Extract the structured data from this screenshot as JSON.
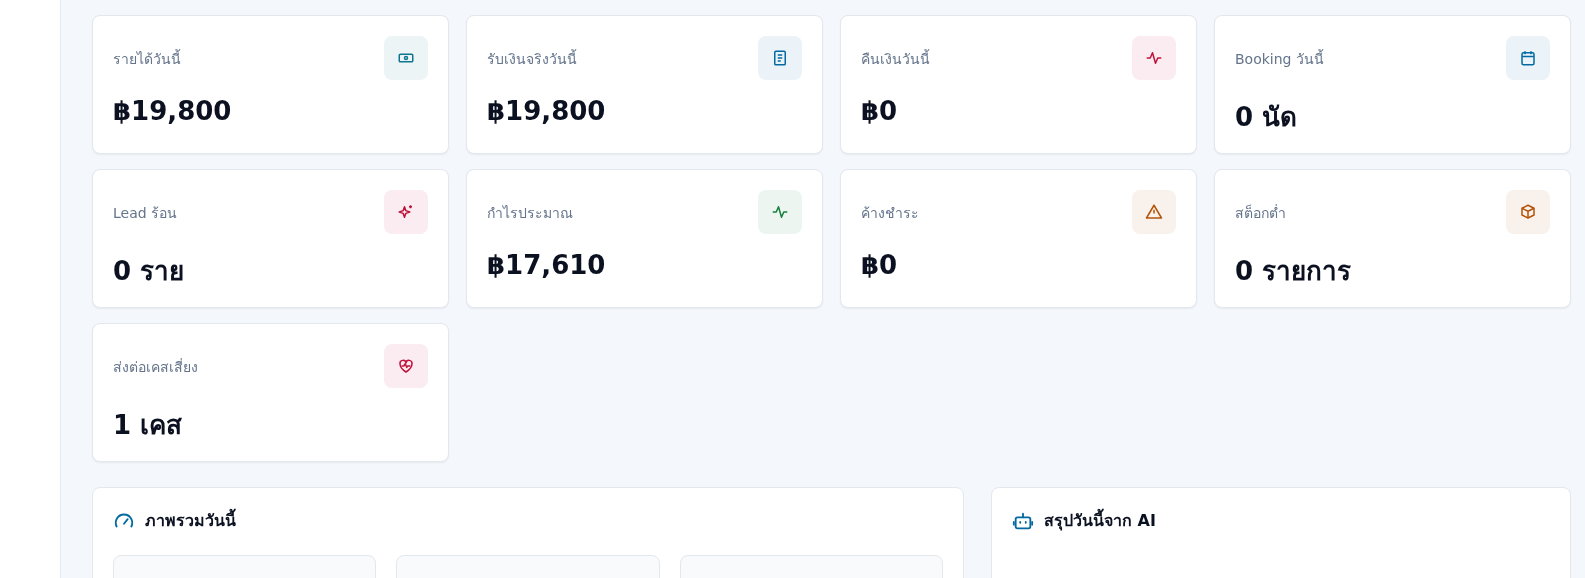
{
  "stats": [
    {
      "label": "รายได้วันนี้",
      "value": "฿19,800",
      "color": "#0e7490"
    },
    {
      "label": "รับเงินจริงวันนี้",
      "value": "฿19,800",
      "color": "#0369a1"
    },
    {
      "label": "คืนเงินวันนี้",
      "value": "฿0",
      "color": "#be123c"
    },
    {
      "label": "Booking วันนี้",
      "value": "0 นัด",
      "color": "#0369a1"
    },
    {
      "label": "Lead ร้อน",
      "value": "0 ราย",
      "color": "#be123c"
    },
    {
      "label": "กำไรประมาณ",
      "value": "฿17,610",
      "color": "#15803d"
    },
    {
      "label": "ค้างชำระ",
      "value": "฿0",
      "color": "#b45309"
    },
    {
      "label": "สต็อกต่ำ",
      "value": "0 รายการ",
      "color": "#b45309"
    },
    {
      "label": "ส่งต่อเคสเสี่ยง",
      "value": "1 เคส",
      "color": "#be123c"
    }
  ],
  "overview": {
    "title": "ภาพรวมวันนี้"
  },
  "ai_summary": {
    "title": "สรุปวันนี้จาก AI"
  }
}
